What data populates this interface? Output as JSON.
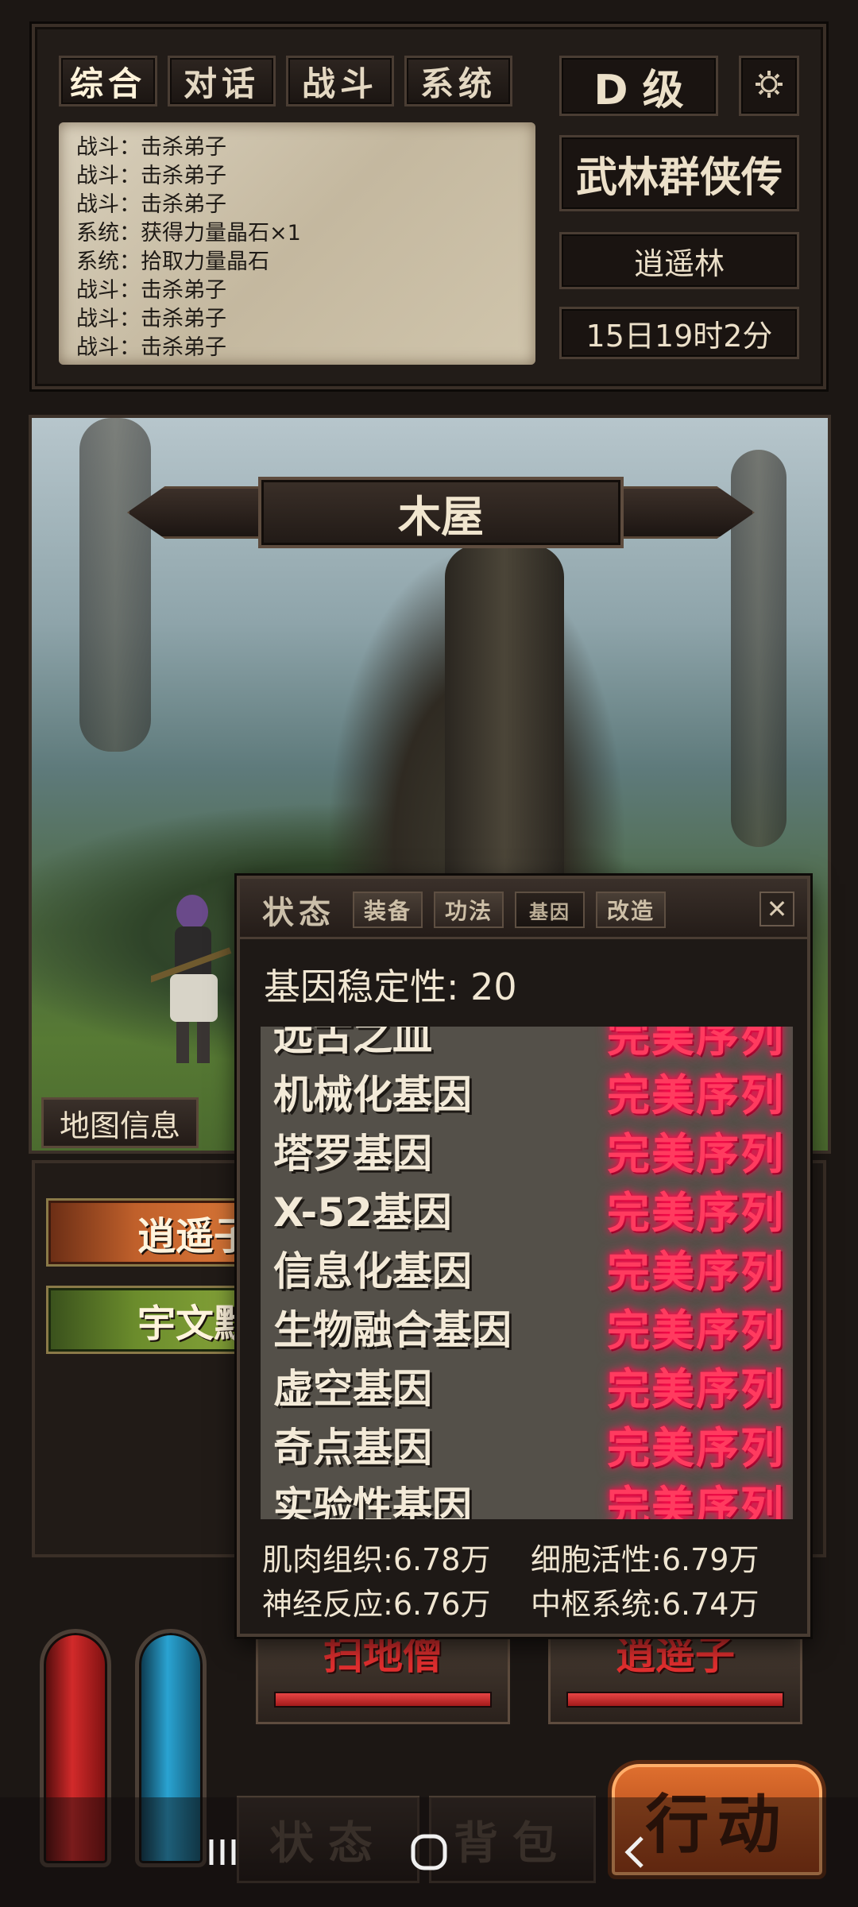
{
  "tabs": [
    "综合",
    "对话",
    "战斗",
    "系统"
  ],
  "rank": "D 级",
  "game_title": "武林群侠传",
  "location": "逍遥林",
  "game_time": "15日19时2分",
  "log": [
    "战斗：击杀弟子",
    "战斗：击杀弟子",
    "战斗：击杀弟子",
    "系统：获得力量晶石×1",
    "系统：拾取力量晶石",
    "战斗：击杀弟子",
    "战斗：击杀弟子",
    "战斗：击杀弟子"
  ],
  "scene": {
    "name": "木屋",
    "map_info_label": "地图信息"
  },
  "npcs": [
    "逍遥子",
    "宇文默"
  ],
  "enemies": [
    {
      "name": "扫地僧",
      "hp": 1.0
    },
    {
      "name": "逍遥子",
      "hp": 1.0
    }
  ],
  "bottom_buttons": {
    "status": "状态",
    "bag": "背包",
    "action": "行动"
  },
  "modal": {
    "title": "状态",
    "tabs": [
      "装备",
      "功法",
      "基因",
      "改造"
    ],
    "active_tab": "基因",
    "close": "✕",
    "stability_label": "基因稳定性:",
    "stability_value": "20",
    "genes": [
      {
        "name": "远古之血",
        "status": "完美序列"
      },
      {
        "name": "机械化基因",
        "status": "完美序列"
      },
      {
        "name": "塔罗基因",
        "status": "完美序列"
      },
      {
        "name": "X-52基因",
        "status": "完美序列"
      },
      {
        "name": "信息化基因",
        "status": "完美序列"
      },
      {
        "name": "生物融合基因",
        "status": "完美序列"
      },
      {
        "name": "虚空基因",
        "status": "完美序列"
      },
      {
        "name": "奇点基因",
        "status": "完美序列"
      },
      {
        "name": "实验性基因",
        "status": "完美序列"
      }
    ],
    "attributes": [
      {
        "label": "肌肉组织",
        "value": "6.78万"
      },
      {
        "label": "细胞活性",
        "value": "6.79万"
      },
      {
        "label": "神经反应",
        "value": "6.76万"
      },
      {
        "label": "中枢系统",
        "value": "6.74万"
      }
    ]
  },
  "icons": {
    "settings": "gear-icon",
    "close": "close-icon",
    "nav_recent": "recent-apps-icon",
    "nav_home": "home-icon",
    "nav_back": "back-icon"
  },
  "colors": {
    "perfect_sequence": "#ff3b5f",
    "enemy_name": "#e22f2f",
    "hp_bar": "#d93333",
    "npc_orange": "#c0602b",
    "npc_green": "#6b8c2c",
    "action_button": "#e0702f"
  }
}
